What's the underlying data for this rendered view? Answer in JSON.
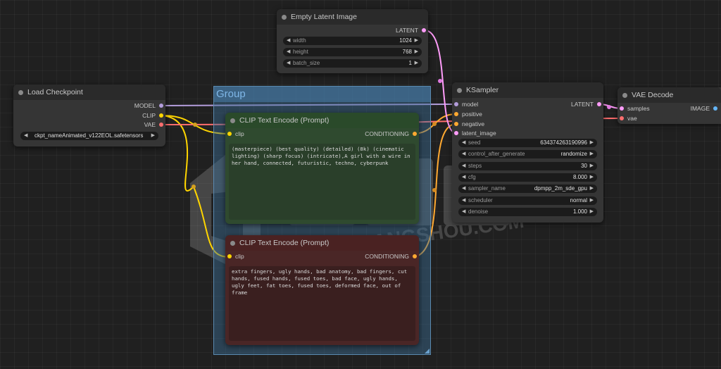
{
  "group": {
    "title": "Group"
  },
  "nodes": {
    "load_checkpoint": {
      "title": "Load Checkpoint",
      "outputs": [
        "MODEL",
        "CLIP",
        "VAE"
      ],
      "ckpt_value": "ckpt_nameAnimated_v122EOL.safetensors"
    },
    "empty_latent": {
      "title": "Empty Latent Image",
      "output": "LATENT",
      "widgets": [
        {
          "label": "width",
          "value": "1024"
        },
        {
          "label": "height",
          "value": "768"
        },
        {
          "label": "batch_size",
          "value": "1"
        }
      ]
    },
    "clip_positive": {
      "title": "CLIP Text Encode (Prompt)",
      "input": "clip",
      "output": "CONDITIONING",
      "text": "(masterpiece) (best quality) (detailed) (8k) (cinematic lighting) (sharp focus) (intricate),A girl with a wire in her hand, connected, futuristic, techno, cyberpunk"
    },
    "clip_negative": {
      "title": "CLIP Text Encode (Prompt)",
      "input": "clip",
      "output": "CONDITIONING",
      "text": "extra fingers, ugly hands, bad anatomy, bad fingers, cut hands, fused hands, fused toes, bad face, ugly hands, ugly feet, fat toes, fused toes, deformed face, out of frame"
    },
    "ksampler": {
      "title": "KSampler",
      "inputs": [
        "model",
        "positive",
        "negative",
        "latent_image"
      ],
      "output": "LATENT",
      "widgets": [
        {
          "label": "seed",
          "value": "634374263190996"
        },
        {
          "label": "control_after_generate",
          "value": "randomize"
        },
        {
          "label": "steps",
          "value": "30"
        },
        {
          "label": "cfg",
          "value": "8.000"
        },
        {
          "label": "sampler_name",
          "value": "dpmpp_2m_sde_gpu"
        },
        {
          "label": "scheduler",
          "value": "normal"
        },
        {
          "label": "denoise",
          "value": "1.000"
        }
      ]
    },
    "vae_decode": {
      "title": "VAE Decode",
      "inputs": [
        "samples",
        "vae"
      ],
      "output": "IMAGE"
    }
  },
  "watermark": {
    "text": "HUABANGSHOU.COM"
  },
  "colors": {
    "model": "#b39ddb",
    "clip": "#ffd500",
    "vae": "#ff6e6e",
    "conditioning": "#ffa931",
    "latent": "#ff9cf9",
    "image": "#64b5f6",
    "positive_node": "#2f4a2f",
    "negative_node": "#4a2626"
  }
}
